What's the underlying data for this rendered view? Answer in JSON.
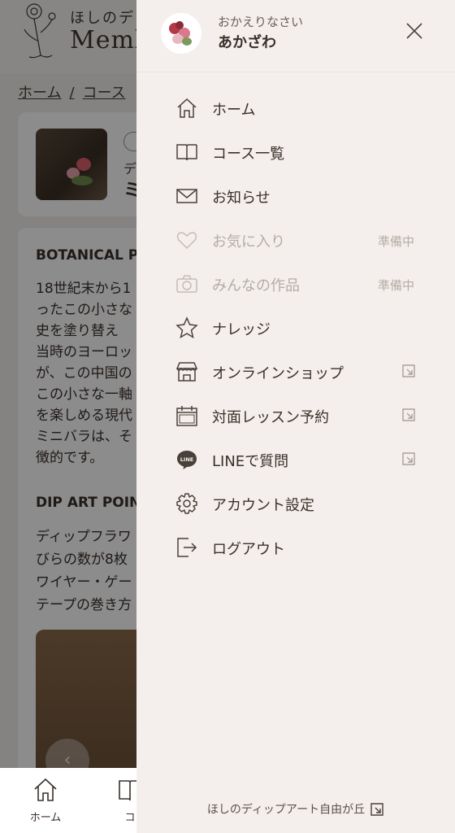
{
  "background": {
    "brand_small": "ほしのデ",
    "brand_large": "Meml",
    "breadcrumb": [
      "ホーム",
      "/",
      "コース"
    ],
    "card_line1": "デ",
    "card_line2": "ミ",
    "article": {
      "heading1": "BOTANICAL PI",
      "paragraph1": [
        "18世紀末から1",
        "ったこの小さな",
        "史を塗り替え",
        "当時のヨーロッ",
        "が、この中国の",
        "この小さな一軸",
        "を楽しめる現代",
        "ミニバラは、そ",
        "徴的です。"
      ],
      "heading2": "DIP ART POINT",
      "paragraph2": [
        "ディップフラワ",
        "びらの数が8枚",
        "ワイヤー・ゲー",
        "テープの巻き方"
      ],
      "prev_arrow": "‹"
    },
    "bottom_nav": [
      {
        "label": "ホーム",
        "icon": "home-icon"
      },
      {
        "label": "コ",
        "icon": "book-icon"
      }
    ]
  },
  "drawer": {
    "greeting": "おかえりなさい",
    "username": "あかざわ",
    "menu": [
      {
        "label": "ホーム",
        "icon": "home-icon",
        "status": "",
        "external": false,
        "disabled": false
      },
      {
        "label": "コース一覧",
        "icon": "book-icon",
        "status": "",
        "external": false,
        "disabled": false
      },
      {
        "label": "お知らせ",
        "icon": "mail-icon",
        "status": "",
        "external": false,
        "disabled": false
      },
      {
        "label": "お気に入り",
        "icon": "heart-icon",
        "status": "準備中",
        "external": false,
        "disabled": true
      },
      {
        "label": "みんなの作品",
        "icon": "camera-icon",
        "status": "準備中",
        "external": false,
        "disabled": true
      },
      {
        "label": "ナレッジ",
        "icon": "star-icon",
        "status": "",
        "external": false,
        "disabled": false
      },
      {
        "label": "オンラインショップ",
        "icon": "shop-icon",
        "status": "",
        "external": true,
        "disabled": false
      },
      {
        "label": "対面レッスン予約",
        "icon": "calendar-icon",
        "status": "",
        "external": true,
        "disabled": false
      },
      {
        "label": "LINEで質問",
        "icon": "line-icon",
        "status": "",
        "external": true,
        "disabled": false
      },
      {
        "label": "アカウント設定",
        "icon": "gear-icon",
        "status": "",
        "external": false,
        "disabled": false
      },
      {
        "label": "ログアウト",
        "icon": "logout-icon",
        "status": "",
        "external": false,
        "disabled": false
      }
    ],
    "footer_label": "ほしのディップアート自由が丘"
  }
}
